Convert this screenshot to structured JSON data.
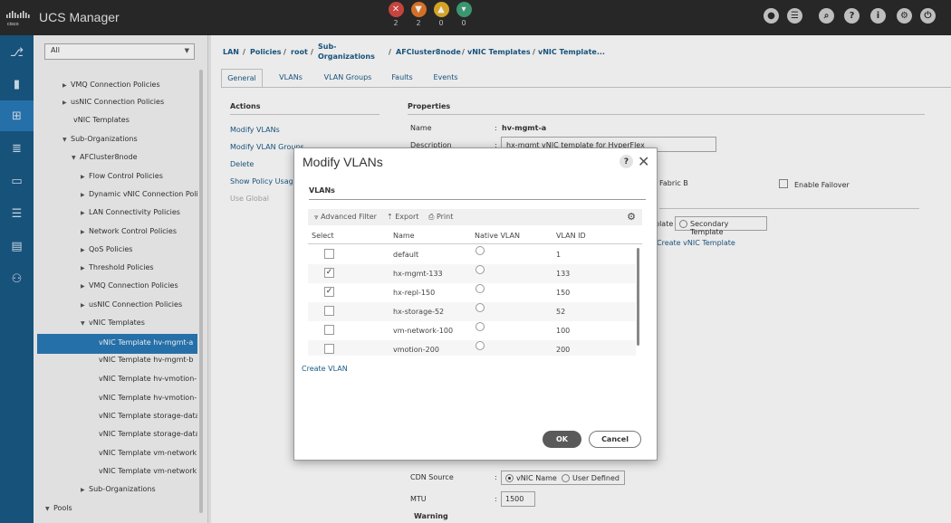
{
  "app": {
    "title": "UCS Manager"
  },
  "faults": [
    {
      "icon": "critical-fault-icon",
      "count": "2",
      "color": "#d84a44",
      "glyph": "✕"
    },
    {
      "icon": "major-fault-icon",
      "count": "2",
      "color": "#e57a2b",
      "glyph": "▼"
    },
    {
      "icon": "minor-fault-icon",
      "count": "0",
      "color": "#e6b12a",
      "glyph": "▲"
    },
    {
      "icon": "warning-fault-icon",
      "count": "0",
      "color": "#3fa37a",
      "glyph": "▾"
    }
  ],
  "header_icons": [
    "status-icon",
    "list-icon",
    "search-icon",
    "help-icon",
    "info-icon",
    "settings-icon",
    "exit-icon"
  ],
  "nav": {
    "filter": "All",
    "tree": [
      {
        "label": "VMQ Connection Policies",
        "arrow": "▶"
      },
      {
        "label": "usNIC Connection Policies",
        "arrow": "▶"
      },
      {
        "label": "vNIC Templates",
        "arrow": ""
      },
      {
        "label": "Sub-Organizations",
        "arrow": "▼"
      },
      {
        "label": "AFCluster8node",
        "arrow": "▼"
      },
      {
        "label": "Flow Control Policies",
        "arrow": "▶"
      },
      {
        "label": "Dynamic vNIC Connection Poli",
        "arrow": "▶"
      },
      {
        "label": "LAN Connectivity Policies",
        "arrow": "▶"
      },
      {
        "label": "Network Control Policies",
        "arrow": "▶"
      },
      {
        "label": "QoS Policies",
        "arrow": "▶"
      },
      {
        "label": "Threshold Policies",
        "arrow": "▶"
      },
      {
        "label": "VMQ Connection Policies",
        "arrow": "▶"
      },
      {
        "label": "usNIC Connection Policies",
        "arrow": "▶"
      },
      {
        "label": "vNIC Templates",
        "arrow": "▼"
      },
      {
        "label": "vNIC Template hv-mgmt-a",
        "arrow": ""
      },
      {
        "label": "vNIC Template hv-mgmt-b",
        "arrow": ""
      },
      {
        "label": "vNIC Template hv-vmotion-",
        "arrow": ""
      },
      {
        "label": "vNIC Template hv-vmotion-",
        "arrow": ""
      },
      {
        "label": "vNIC Template storage-data",
        "arrow": ""
      },
      {
        "label": "vNIC Template storage-data",
        "arrow": ""
      },
      {
        "label": "vNIC Template vm-network",
        "arrow": ""
      },
      {
        "label": "vNIC Template vm-network",
        "arrow": ""
      },
      {
        "label": "Sub-Organizations",
        "arrow": "▶"
      },
      {
        "label": "Pools",
        "arrow": "▼"
      }
    ]
  },
  "breadcrumb": [
    "LAN",
    "/",
    "Policies",
    "/",
    "root",
    "/",
    "Sub-",
    "Organizations",
    "/",
    "AFCluster8node",
    "/",
    "vNIC Templates",
    "/",
    "vNIC Template..."
  ],
  "tabs": [
    "General",
    "VLANs",
    "VLAN Groups",
    "Faults",
    "Events"
  ],
  "actions": {
    "heading": "Actions",
    "items": [
      "Modify VLANs",
      "Modify VLAN Groups",
      "Delete",
      "Show Policy Usage",
      "Use Global"
    ]
  },
  "properties": {
    "heading": "Properties",
    "name_label": "Name",
    "name_value": "hv-mgmt-a",
    "description_label": "Description",
    "description_value": "hx-mgmt vNIC template for HyperFlex",
    "fabric_b": "Fabric B",
    "enable_failover": "Enable Failover",
    "template_type_partial": "plate",
    "secondary_template": "Secondary Template",
    "create_vnic_template": "Create vNIC Template",
    "cdn_source_label": "CDN Source",
    "cdn_vnic_name": "vNIC Name",
    "cdn_user_defined": "User Defined",
    "mtu_label": "MTU",
    "mtu_value": "1500",
    "warning_label": "Warning"
  },
  "dialog": {
    "title": "Modify VLANs",
    "help": "?",
    "section": "VLANs",
    "toolbar": {
      "advanced_filter": "Advanced Filter",
      "export": "Export",
      "print": "Print"
    },
    "columns": [
      "Select",
      "Name",
      "Native VLAN",
      "VLAN ID"
    ],
    "rows": [
      {
        "name": "default",
        "vlan_id": "1",
        "selected": false
      },
      {
        "name": "hx-mgmt-133",
        "vlan_id": "133",
        "selected": true
      },
      {
        "name": "hx-repl-150",
        "vlan_id": "150",
        "selected": true
      },
      {
        "name": "hx-storage-52",
        "vlan_id": "52",
        "selected": false
      },
      {
        "name": "vm-network-100",
        "vlan_id": "100",
        "selected": false
      },
      {
        "name": "vmotion-200",
        "vlan_id": "200",
        "selected": false
      }
    ],
    "create_vlan": "Create VLAN",
    "ok": "OK",
    "cancel": "Cancel"
  }
}
